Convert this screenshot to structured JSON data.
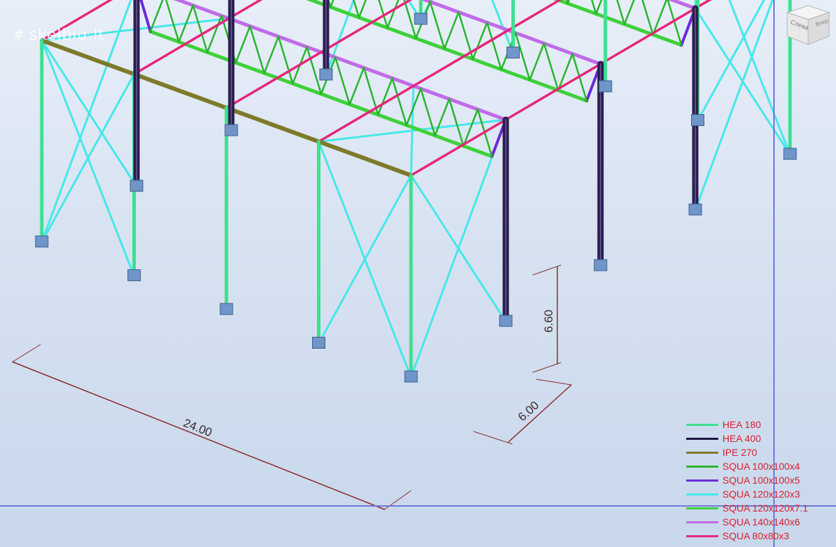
{
  "watermark": {
    "text": "skelbiu.lt",
    "icon": "grid-hash-icon"
  },
  "viewcube": {
    "face_left": "Слева",
    "face_right": "Впер"
  },
  "dimensions": {
    "length": "24.00",
    "bay": "6.00",
    "height": "6.60"
  },
  "legend": [
    {
      "label": "HEA 180",
      "color": "#3de08f"
    },
    {
      "label": "HEA 400",
      "color": "#1e1440"
    },
    {
      "label": "IPE 270",
      "color": "#7d7a2a"
    },
    {
      "label": "SQUA 100x100x4",
      "color": "#27b52e"
    },
    {
      "label": "SQUA 100x100x5",
      "color": "#6a2ad8"
    },
    {
      "label": "SQUA 120x120x3",
      "color": "#47e7ea"
    },
    {
      "label": "SQUA 120x120x7.1",
      "color": "#3ed13a"
    },
    {
      "label": "SQUA 140x140x6",
      "color": "#c06be8"
    },
    {
      "label": "SQUA 80x80x3",
      "color": "#e6267a"
    }
  ],
  "colors": {
    "hea180": "#3de08f",
    "hea400": "#2a1e4d",
    "ipe270": "#7d7a2a",
    "squa100x4": "#27b52e",
    "squa100x5": "#6a2ad8",
    "squa120x3": "#47e7ea",
    "squa120x71": "#3ed13a",
    "squa140x6": "#c06be8",
    "squa80x3": "#e6267a",
    "dim": "#8b2b2b",
    "footing": "#6f95c9"
  }
}
